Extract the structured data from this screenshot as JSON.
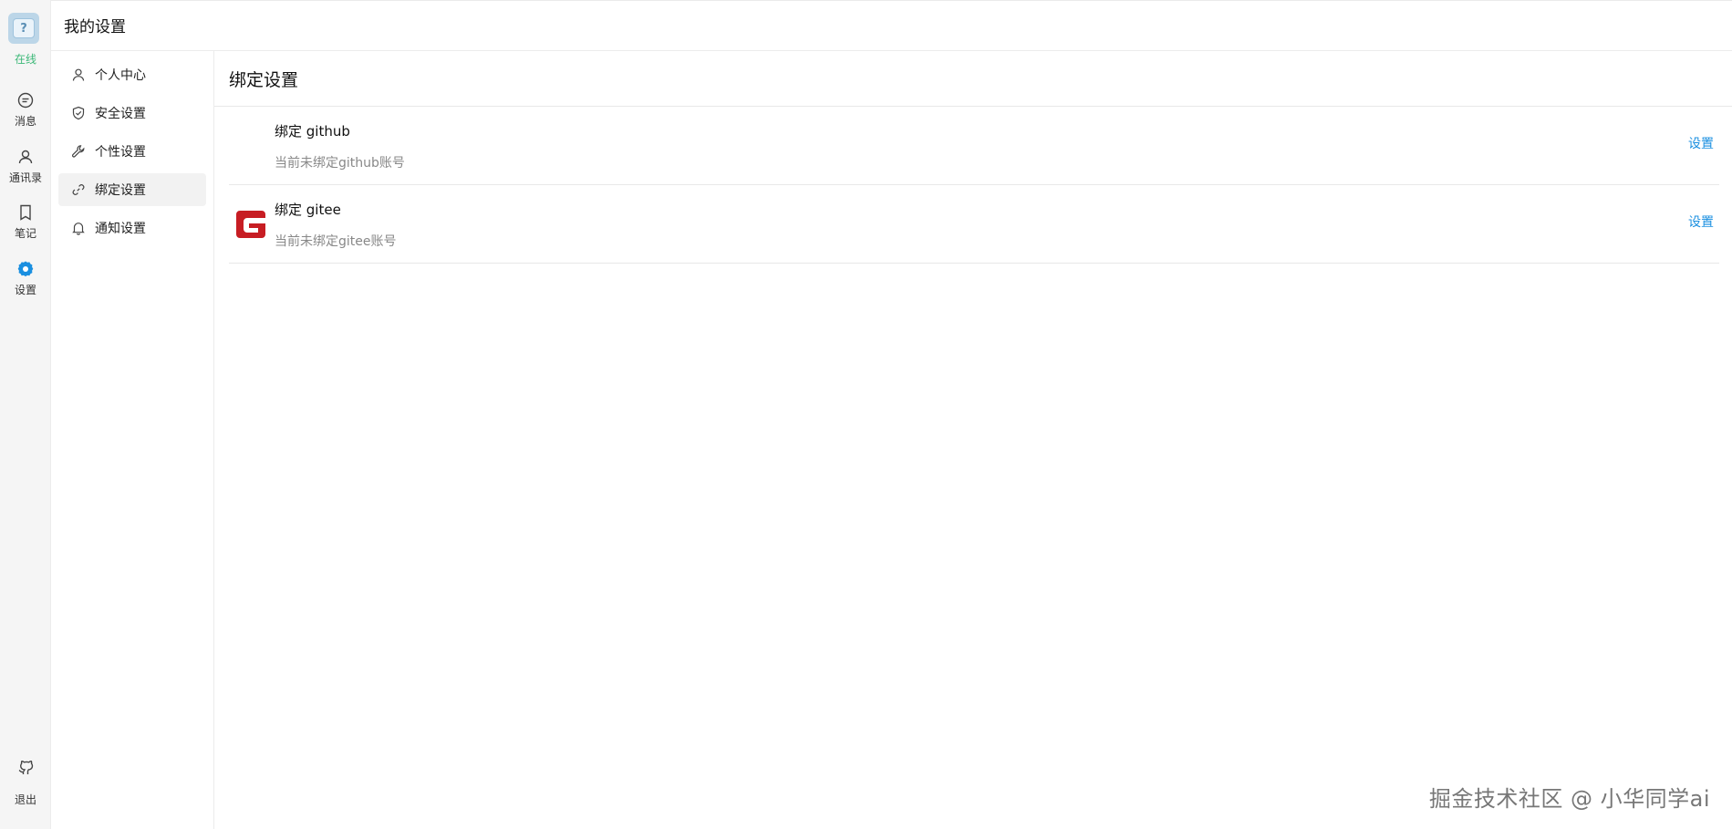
{
  "rail": {
    "status": "在线",
    "items": [
      {
        "label": "消息",
        "icon": "message-icon"
      },
      {
        "label": "通讯录",
        "icon": "contacts-icon"
      },
      {
        "label": "笔记",
        "icon": "notebook-icon"
      },
      {
        "label": "设置",
        "icon": "gear-icon",
        "active": true
      }
    ],
    "logout": {
      "label": "退出",
      "icon": "github-icon"
    }
  },
  "header": {
    "title": "我的设置"
  },
  "subnav": {
    "items": [
      {
        "label": "个人中心",
        "icon": "user-icon"
      },
      {
        "label": "安全设置",
        "icon": "shield-icon"
      },
      {
        "label": "个性设置",
        "icon": "wrench-icon"
      },
      {
        "label": "绑定设置",
        "icon": "link-icon",
        "active": true
      },
      {
        "label": "通知设置",
        "icon": "bell-icon"
      }
    ]
  },
  "main": {
    "title": "绑定设置",
    "bindings": [
      {
        "name": "绑定 github",
        "desc": "当前未绑定github账号",
        "action": "设置"
      },
      {
        "name": "绑定 gitee",
        "desc": "当前未绑定gitee账号",
        "action": "设置"
      }
    ]
  },
  "colors": {
    "accent": "#1a8fe0",
    "online": "#3cb878",
    "gitee": "#c71d23"
  },
  "watermark": "掘金技术社区 @ 小华同学ai"
}
